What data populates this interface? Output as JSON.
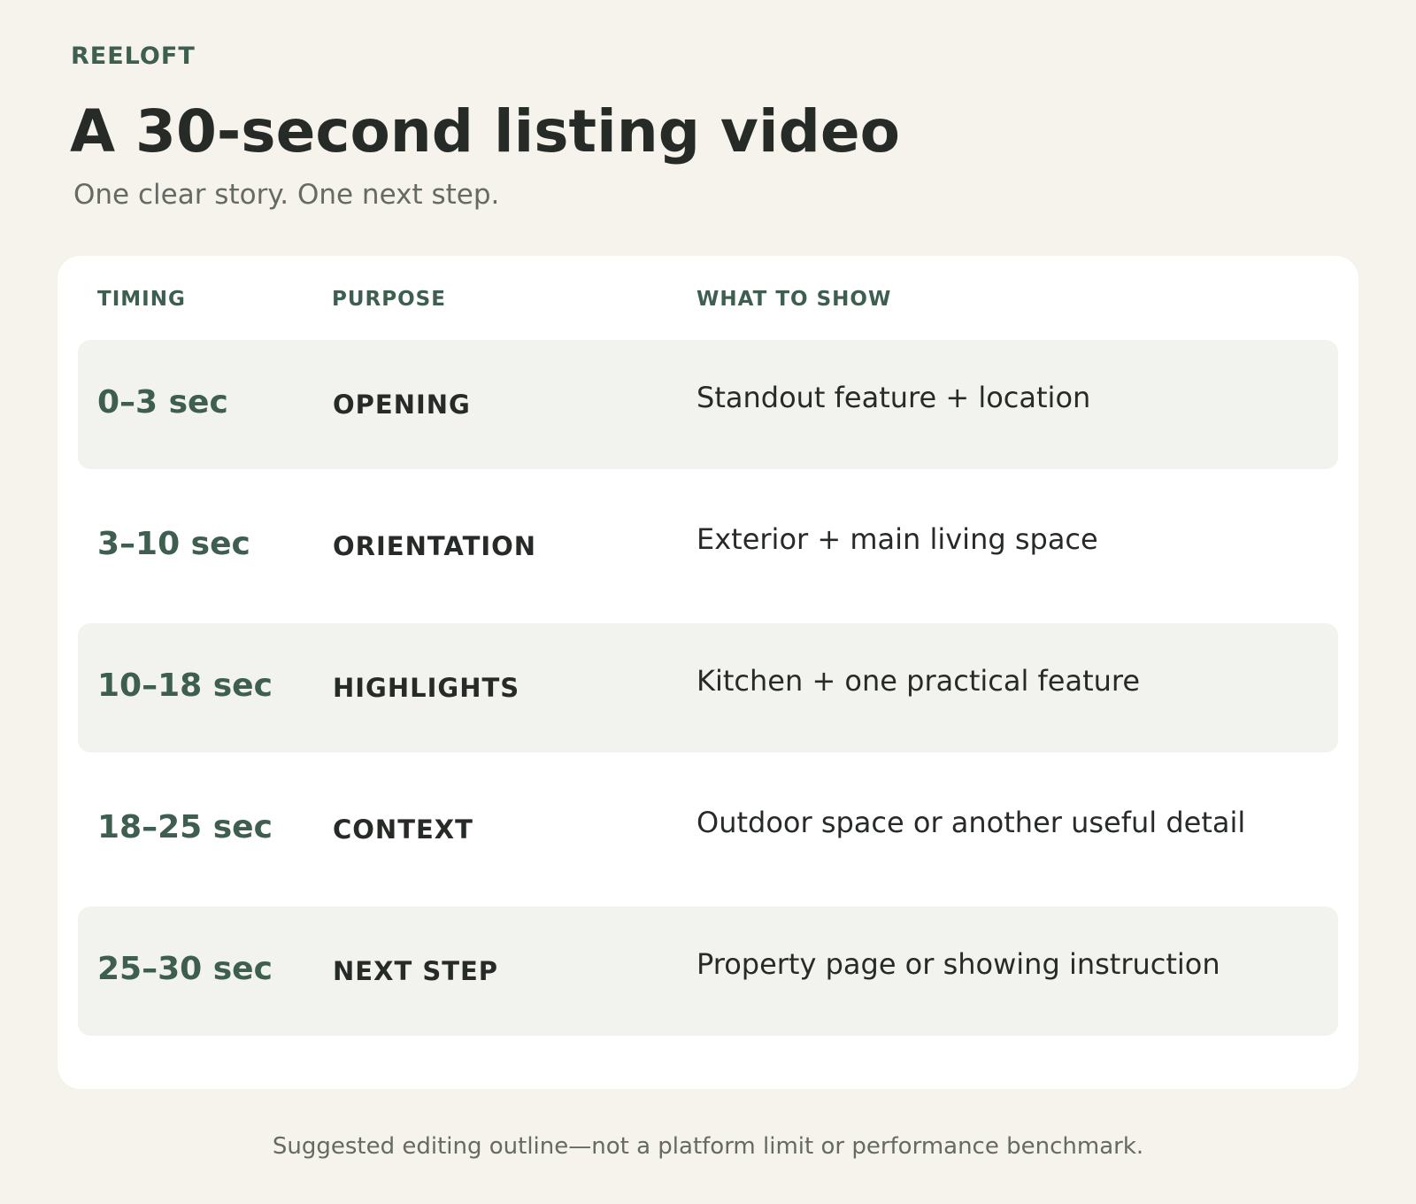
{
  "brand": "REELOFT",
  "title": "A 30-second listing video",
  "subtitle": "One clear story. One next step.",
  "table": {
    "headers": {
      "timing": "TIMING",
      "purpose": "PURPOSE",
      "show": "WHAT TO SHOW"
    },
    "rows": [
      {
        "timing": "0–3 sec",
        "purpose": "OPENING",
        "show": "Standout feature + location"
      },
      {
        "timing": "3–10 sec",
        "purpose": "ORIENTATION",
        "show": "Exterior + main living space"
      },
      {
        "timing": "10–18 sec",
        "purpose": "HIGHLIGHTS",
        "show": "Kitchen + one practical feature"
      },
      {
        "timing": "18–25 sec",
        "purpose": "CONTEXT",
        "show": "Outdoor space or another useful detail"
      },
      {
        "timing": "25–30 sec",
        "purpose": "NEXT STEP",
        "show": "Property page or showing instruction"
      }
    ]
  },
  "footnote": "Suggested editing outline—not a platform limit or performance benchmark.",
  "colors": {
    "background": "#f5f3ec",
    "accent": "#3e5e50",
    "text": "#272b27",
    "muted": "#656a63",
    "row_shade": "#f2f3ee",
    "card": "#ffffff"
  }
}
